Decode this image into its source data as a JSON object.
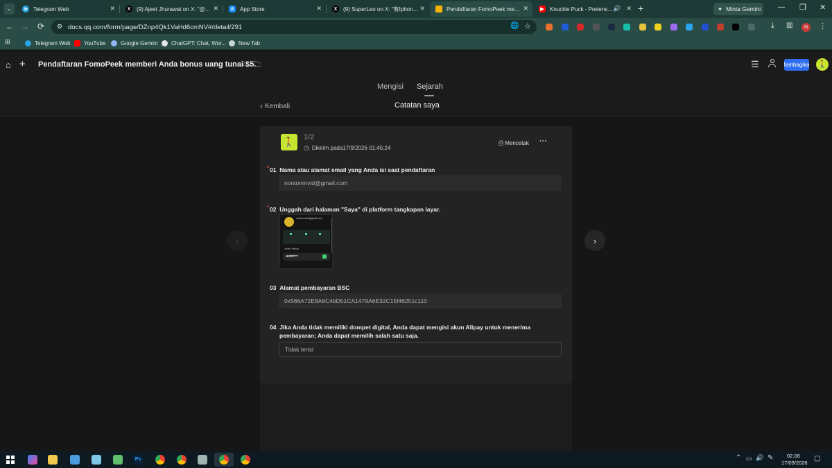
{
  "browser": {
    "tabs": [
      {
        "title": "Telegram Web",
        "icon": "telegram-icon"
      },
      {
        "title": "(9) Ajeet Jhurawat on X: \"@duc",
        "icon": "x-icon"
      },
      {
        "title": "App Store",
        "icon": "appstore-icon"
      },
      {
        "title": "(9) SuperLeo on X: \"有Iphone的",
        "icon": "x-icon"
      },
      {
        "title": "Pendaftaran FomoPeek membe",
        "icon": "docs-icon",
        "active": true
      },
      {
        "title": "Knuckle Puck - Pretense (Of",
        "icon": "youtube-icon"
      }
    ],
    "gemini_button": "Minta Gemini",
    "address": "docs.qq.com/form/page/DZnp4Qk1VaHd6cmNV#/detail/291",
    "bookmarks": [
      "Telegram Web",
      "YouTube",
      "Google Gemini",
      "ChatGPT: Chat, Wor...",
      "New Tab"
    ],
    "profile_initial": "N"
  },
  "app": {
    "doc_title": "Pendaftaran FomoPeek memberi Anda bonus uang tunai $5.",
    "share_label": "Membagikan",
    "tabs": [
      "Mengisi",
      "Sejarah"
    ],
    "back_label": "Kembali",
    "page_title": "Catatan saya"
  },
  "record": {
    "index": "1/2",
    "submitted": "Dikirim pada17/9/2026 01:45:24",
    "print_label": "Mencetak",
    "more": "···"
  },
  "questions": [
    {
      "num": "01",
      "required": true,
      "label": "Nama atau alamat email yang Anda isi saat pendaftaran",
      "answer": "nontonmvid@gmail.com"
    },
    {
      "num": "02",
      "required": true,
      "label": "Unggah dari halaman \"Saya\" di platform tangkapan layar."
    },
    {
      "num": "03",
      "required": false,
      "label": "Alamat pembayaran BSC",
      "answer": "0x566A72E8A6C4bD51CA1479A6E32C15f46251c110"
    },
    {
      "num": "04",
      "required": false,
      "label": "Jika Anda tidak memiliki dompet digital, Anda dapat mengisi akun Alipay untuk menerima pembayaran; Anda dapat memilih salah satu saja.",
      "answer": "Tidak terisi"
    }
  ],
  "thumbnail": {
    "email": "nontonmvid@gmail.com",
    "section": "Invite Friends",
    "code": "HXPPTT"
  },
  "taskbar": {
    "time": "02.06",
    "date": "17/09/2026"
  },
  "colors": {
    "accent_blue": "#2f6ef3",
    "avatar_green": "#c6e530",
    "required_red": "#e54545",
    "tab_bg": "#1e3a36"
  }
}
